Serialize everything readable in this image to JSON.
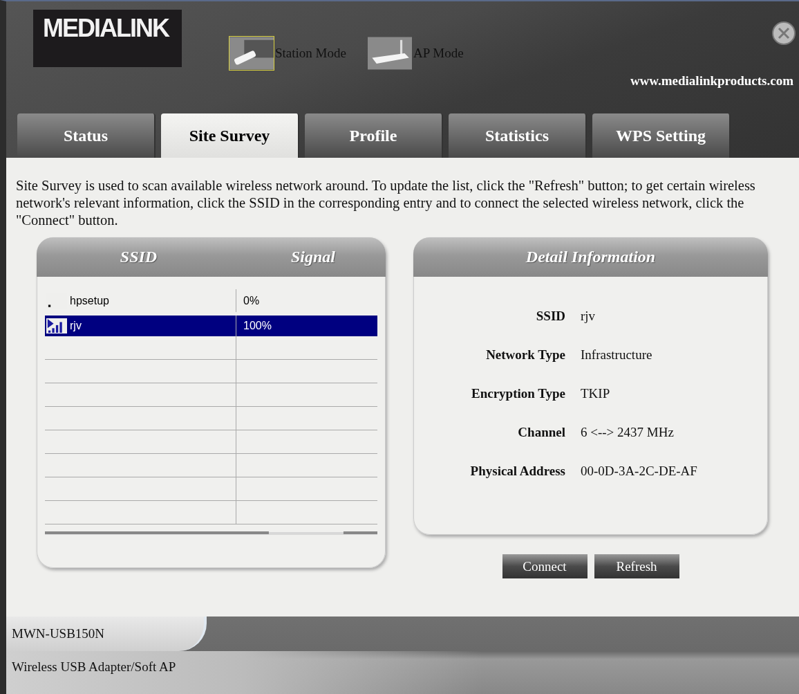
{
  "header": {
    "logo": "MEDIALINK",
    "website": "www.medialinkproducts.com",
    "modes": [
      {
        "label": "Station Mode",
        "kind": "station",
        "selected": true
      },
      {
        "label": "AP Mode",
        "kind": "ap",
        "selected": false
      }
    ]
  },
  "tabs": [
    {
      "label": "Status",
      "selected": false
    },
    {
      "label": "Site Survey",
      "selected": true
    },
    {
      "label": "Profile",
      "selected": false
    },
    {
      "label": "Statistics",
      "selected": false
    },
    {
      "label": "WPS Setting",
      "selected": false
    }
  ],
  "description": "Site Survey is used to scan available wireless network around. To update the list, click the \"Refresh\" button; to get certain wireless network's relevant information, click the SSID in the corresponding entry and to connect the selected wireless network, click the \"Connect\" button.",
  "survey_table": {
    "columns": [
      "SSID",
      "Signal"
    ],
    "rows": [
      {
        "ssid": "hpsetup",
        "signal": "0%",
        "selected": false,
        "connected": false
      },
      {
        "ssid": "rjv",
        "signal": "100%",
        "selected": true,
        "connected": true
      }
    ]
  },
  "detail": {
    "title": "Detail Information",
    "fields": [
      {
        "label": "SSID",
        "value": "rjv"
      },
      {
        "label": "Network Type",
        "value": "Infrastructure"
      },
      {
        "label": "Encryption Type",
        "value": "TKIP"
      },
      {
        "label": "Channel",
        "value": "6 <--> 2437 MHz"
      },
      {
        "label": "Physical Address",
        "value": "00-0D-3A-2C-DE-AF"
      }
    ]
  },
  "buttons": [
    "Connect",
    "Refresh"
  ],
  "footer": {
    "model": "MWN-USB150N",
    "description": "Wireless USB Adapter/Soft AP"
  }
}
